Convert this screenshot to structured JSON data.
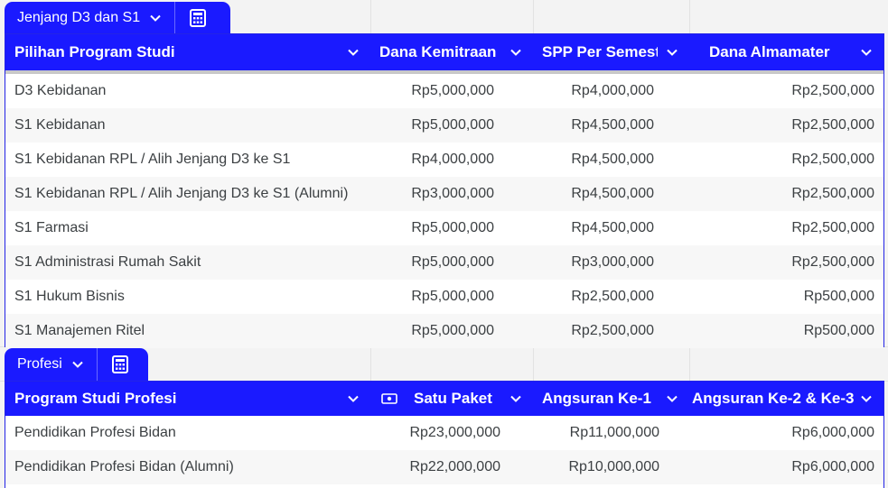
{
  "tables": [
    {
      "tab_label": "Jenjang D3 dan S1",
      "columns": [
        "Pilihan Program Studi",
        "Dana Kemitraan",
        "SPP Per Semester",
        "Dana Almamater"
      ],
      "rows": [
        [
          "D3 Kebidanan",
          "Rp5,000,000",
          "Rp4,000,000",
          "Rp2,500,000"
        ],
        [
          "S1 Kebidanan",
          "Rp5,000,000",
          "Rp4,500,000",
          "Rp2,500,000"
        ],
        [
          "S1 Kebidanan RPL / Alih Jenjang D3 ke S1",
          "Rp4,000,000",
          "Rp4,500,000",
          "Rp2,500,000"
        ],
        [
          "S1 Kebidanan RPL / Alih Jenjang D3 ke S1 (Alumni)",
          "Rp3,000,000",
          "Rp4,500,000",
          "Rp2,500,000"
        ],
        [
          "S1 Farmasi",
          "Rp5,000,000",
          "Rp4,500,000",
          "Rp2,500,000"
        ],
        [
          "S1 Administrasi Rumah Sakit",
          "Rp5,000,000",
          "Rp3,000,000",
          "Rp2,500,000"
        ],
        [
          "S1 Hukum Bisnis",
          "Rp5,000,000",
          "Rp2,500,000",
          "Rp500,000"
        ],
        [
          "S1 Manajemen Ritel",
          "Rp5,000,000",
          "Rp2,500,000",
          "Rp500,000"
        ]
      ]
    },
    {
      "tab_label": "Profesi",
      "columns": [
        "Program Studi Profesi",
        "Satu Paket",
        "Angsuran Ke-1",
        "Angsuran Ke-2 & Ke-3"
      ],
      "rows": [
        [
          "Pendidikan Profesi Bidan",
          "Rp23,000,000",
          "Rp11,000,000",
          "Rp6,000,000"
        ],
        [
          "Pendidikan Profesi Bidan (Alumni)",
          "Rp22,000,000",
          "Rp10,000,000",
          "Rp6,000,000"
        ]
      ]
    }
  ],
  "icons": {
    "dropdown": "chevron-down-icon",
    "calculator": "calculator-icon",
    "currency": "money-icon"
  },
  "colors": {
    "header_blue": "#1a1aff",
    "row_alt": "#f7f7f7"
  }
}
